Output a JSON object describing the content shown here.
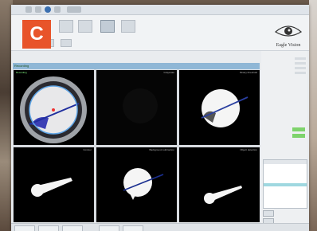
{
  "figure_label": "C",
  "logo": {
    "text": "Eagle Vision"
  },
  "ribbon": {
    "buttons": [
      "",
      "",
      "",
      "",
      ""
    ],
    "row2": [
      "",
      "",
      ""
    ]
  },
  "status": {
    "left": "Recording"
  },
  "views": [
    {
      "title": "Recording",
      "accent": "#8fd98f"
    },
    {
      "title": "Grayscale",
      "accent": "#bbbbbb"
    },
    {
      "title": "Binary threshold",
      "accent": "#bbbbbb"
    },
    {
      "title": "Contour",
      "accent": "#bbbbbb"
    },
    {
      "title": "Background subtraction",
      "accent": "#bbbbbb"
    },
    {
      "title": "Object detection",
      "accent": "#bbbbbb"
    }
  ],
  "panel": {
    "rows": [
      "",
      "",
      "",
      "",
      "",
      ""
    ],
    "list_items": [
      "",
      "",
      "",
      "",
      "",
      "",
      ""
    ]
  },
  "colors": {
    "accent": "#e8542a",
    "ok": "#7ed36c",
    "highlight": "#9fd8e0"
  }
}
